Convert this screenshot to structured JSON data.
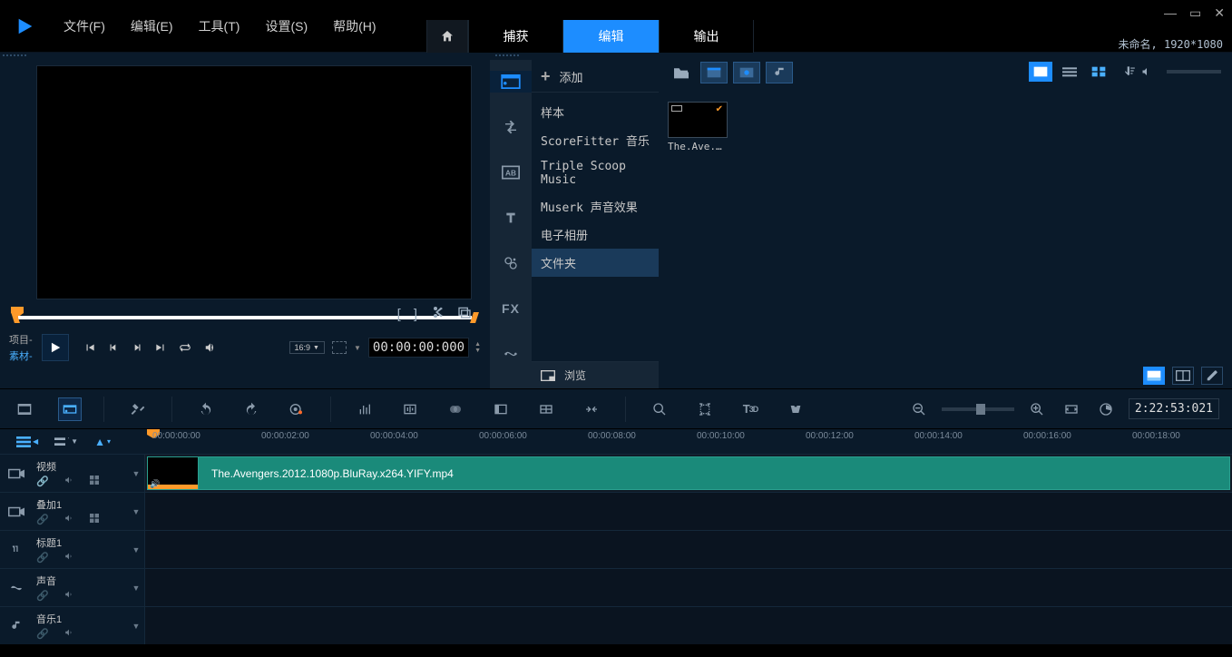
{
  "menubar": {
    "file": "文件(F)",
    "edit": "编辑(E)",
    "tools": "工具(T)",
    "settings": "设置(S)",
    "help": "帮助(H)"
  },
  "mode_tabs": {
    "capture": "捕获",
    "edit": "编辑",
    "output": "输出"
  },
  "project_status": "未命名, 1920*1080",
  "preview": {
    "mode_project": "项目-",
    "mode_clip": "素材-",
    "aspect": "16:9",
    "timecode": "00:00:00:000"
  },
  "library": {
    "add": "添加",
    "items": {
      "sample": "样本",
      "scorefitter": "ScoreFitter 音乐",
      "triplescoop": "Triple Scoop Music",
      "muserk": "Muserk 声音效果",
      "ealbum": "电子相册",
      "folders": "文件夹"
    },
    "browse": "浏览",
    "thumb_label": "The.Ave..."
  },
  "timeline": {
    "duration": "2:22:53:021",
    "ruler": [
      "00:00:00:00",
      "00:00:02:00",
      "00:00:04:00",
      "00:00:06:00",
      "00:00:08:00",
      "00:00:10:00",
      "00:00:12:00",
      "00:00:14:00",
      "00:00:16:00",
      "00:00:18:00"
    ],
    "tracks": {
      "video": "视频",
      "overlay": "叠加1",
      "title": "标题1",
      "voice": "声音",
      "music": "音乐1"
    },
    "clip_label": "The.Avengers.2012.1080p.BluRay.x264.YIFY.mp4"
  }
}
